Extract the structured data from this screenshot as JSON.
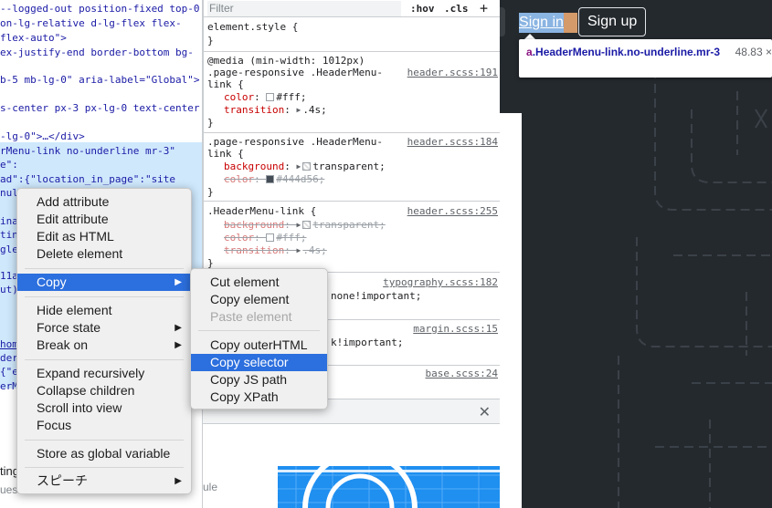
{
  "elements_panel": {
    "lines": [
      {
        "text": "--logged-out position-fixed top-0",
        "y": 0
      },
      {
        "text": "on-lg-relative d-lg-flex flex-",
        "y": 0
      },
      {
        "text": "flex-auto\">",
        "y": 0
      },
      {
        "text": "ex-justify-end border-bottom bg-",
        "y": 0
      },
      {
        "text": "b-5 mb-lg-0\" aria-label=\"Global\">",
        "y": 0
      },
      {
        "text": "s-center px-3 px-lg-0 text-center",
        "y": 0
      },
      {
        "text": "-lg-0\">…</div>",
        "y": 0
      },
      {
        "text": "rMenu-link no-underline mr-3\"",
        "y": 0
      },
      {
        "text": "e\":",
        "y": 0
      },
      {
        "text": "ad\":{\"location_in_page\":\"site",
        "y": 0
      },
      {
        "text": "null",
        "y": 0
      },
      {
        "text": "ina",
        "y": 0
      },
      {
        "text": "tin",
        "y": 0
      },
      {
        "text": "gle",
        "y": 0
      },
      {
        "text": "11a",
        "y": 0
      },
      {
        "text": "ut)",
        "y": 0
      },
      {
        "text": "hom",
        "y": 0
      },
      {
        "text": "der",
        "y": 0
      },
      {
        "text": "{\"e",
        "y": 0
      },
      {
        "text": "erM",
        "y": 0
      },
      {
        "text": "tin",
        "y": 0
      },
      {
        "text": "ues",
        "y": 0
      }
    ]
  },
  "styles_panel": {
    "filter_placeholder": "Filter",
    "hov_label": ":hov",
    "cls_label": ".cls",
    "add_label": "+",
    "element_style": "element.style {",
    "close_brace": "}",
    "rule1": {
      "l1": "@media (min-width: 1012px)",
      "l2": ".page-responsive .HeaderMenu-",
      "l3": "link {",
      "src": "header.scss:191",
      "p1n": "color",
      "p1v": "#fff;",
      "p2n": "transition",
      "p2v": ".4s;"
    },
    "rule2": {
      "l1": ".page-responsive .HeaderMenu-",
      "l2": "link {",
      "src": "header.scss:184",
      "p1n": "background",
      "p1v": "transparent;",
      "p2n": "color",
      "p2v": "#444d56;"
    },
    "rule3": {
      "l1": ".HeaderMenu-link {",
      "src": "header.scss:255",
      "p1n": "background",
      "p1v": "transparent;",
      "p2n": "color",
      "p2v": "#fff;",
      "p3n": "transition",
      "p3v": ".4s;"
    },
    "rule4": {
      "src": "typography.scss:182",
      "frag": "none!important;"
    },
    "rule5": {
      "src": "margin.scss:15",
      "frag": "k!important;"
    },
    "rule6": {
      "src": "base.scss:24"
    }
  },
  "drawer": {
    "close": "✕"
  },
  "page": {
    "sign_in": "Sign in",
    "sign_up": "Sign up",
    "tooltip_tag": "a",
    "tooltip_class": ".HeaderMenu-link.no-underline.mr-3",
    "tooltip_size": "48.83 ×"
  },
  "context_menu": {
    "items": [
      {
        "label": "Add attribute"
      },
      {
        "label": "Edit attribute"
      },
      {
        "label": "Edit as HTML"
      },
      {
        "label": "Delete element"
      },
      {
        "label": "Copy",
        "submenu": true,
        "highlighted": true
      },
      {
        "label": "Hide element"
      },
      {
        "label": "Force state",
        "submenu": true
      },
      {
        "label": "Break on",
        "submenu": true
      },
      {
        "label": "Expand recursively"
      },
      {
        "label": "Collapse children"
      },
      {
        "label": "Scroll into view"
      },
      {
        "label": "Focus"
      },
      {
        "label": "Store as global variable"
      },
      {
        "label": "スピーチ",
        "submenu": true
      }
    ]
  },
  "copy_submenu": {
    "items": [
      {
        "label": "Cut element"
      },
      {
        "label": "Copy element"
      },
      {
        "label": "Paste element",
        "disabled": true
      },
      {
        "label": "Copy outerHTML"
      },
      {
        "label": "Copy selector",
        "highlighted": true
      },
      {
        "label": "Copy JS path"
      },
      {
        "label": "Copy XPath"
      }
    ]
  },
  "under_menu_fragments": {
    "a": "ting",
    "b": "ues",
    "c": "ule"
  },
  "colors": {
    "menu_highlight": "#2c6fde",
    "page_bg": "#24292e",
    "selected_row": "#cfe8fc"
  }
}
